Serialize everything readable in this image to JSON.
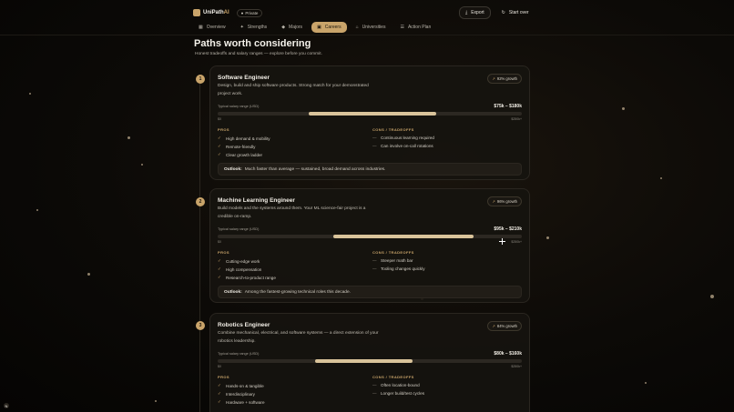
{
  "app": {
    "name": "UniPath",
    "suffix": "AI",
    "private_label": "Private"
  },
  "header": {
    "export_label": "Export",
    "start_over_label": "Start over"
  },
  "tabs": [
    {
      "label": "Overview"
    },
    {
      "label": "Strengths"
    },
    {
      "label": "Majors"
    },
    {
      "label": "Careers"
    },
    {
      "label": "Universities"
    },
    {
      "label": "Action Plan"
    }
  ],
  "page": {
    "title": "Paths worth considering",
    "subtitle": "Honest tradeoffs and salary ranges — explore before you commit."
  },
  "labels": {
    "salary": "Typical salary range (USD)",
    "min": "$0",
    "max": "$250k+",
    "pros": "PROS",
    "cons": "CONS / TRADEOFFS",
    "outlook": "Outlook:"
  },
  "accent_color": "#c9a46a",
  "careers": [
    {
      "rank": "1",
      "title": "Software Engineer",
      "growth": "92% growth",
      "description": "Design, build and ship software products. Strong match for your demonstrated project work.",
      "salary_range": "$75k – $180k",
      "salary_min_k": 75,
      "salary_max_k": 180,
      "pros": [
        "High demand & mobility",
        "Remote-friendly",
        "Clear growth ladder"
      ],
      "cons": [
        "Continuous learning required",
        "Can involve on-call rotations"
      ],
      "outlook": "Much faster than average — sustained, broad demand across industries."
    },
    {
      "rank": "2",
      "title": "Machine Learning Engineer",
      "growth": "96% growth",
      "description": "Build models and the systems around them. Your ML science-fair project is a credible on-ramp.",
      "salary_range": "$95k – $210k",
      "salary_min_k": 95,
      "salary_max_k": 210,
      "pros": [
        "Cutting-edge work",
        "High compensation",
        "Research-to-product range"
      ],
      "cons": [
        "Steeper math bar",
        "Tooling changes quickly"
      ],
      "outlook": "Among the fastest-growing technical roles this decade."
    },
    {
      "rank": "3",
      "title": "Robotics Engineer",
      "growth": "84% growth",
      "description": "Combine mechanical, electrical, and software systems — a direct extension of your robotics leadership.",
      "salary_range": "$80k – $160k",
      "salary_min_k": 80,
      "salary_max_k": 160,
      "pros": [
        "Hands-on & tangible",
        "Interdisciplinary",
        "Hardware + software"
      ],
      "cons": [
        "Often location-bound",
        "Longer build/test cycles"
      ],
      "outlook": ""
    }
  ]
}
